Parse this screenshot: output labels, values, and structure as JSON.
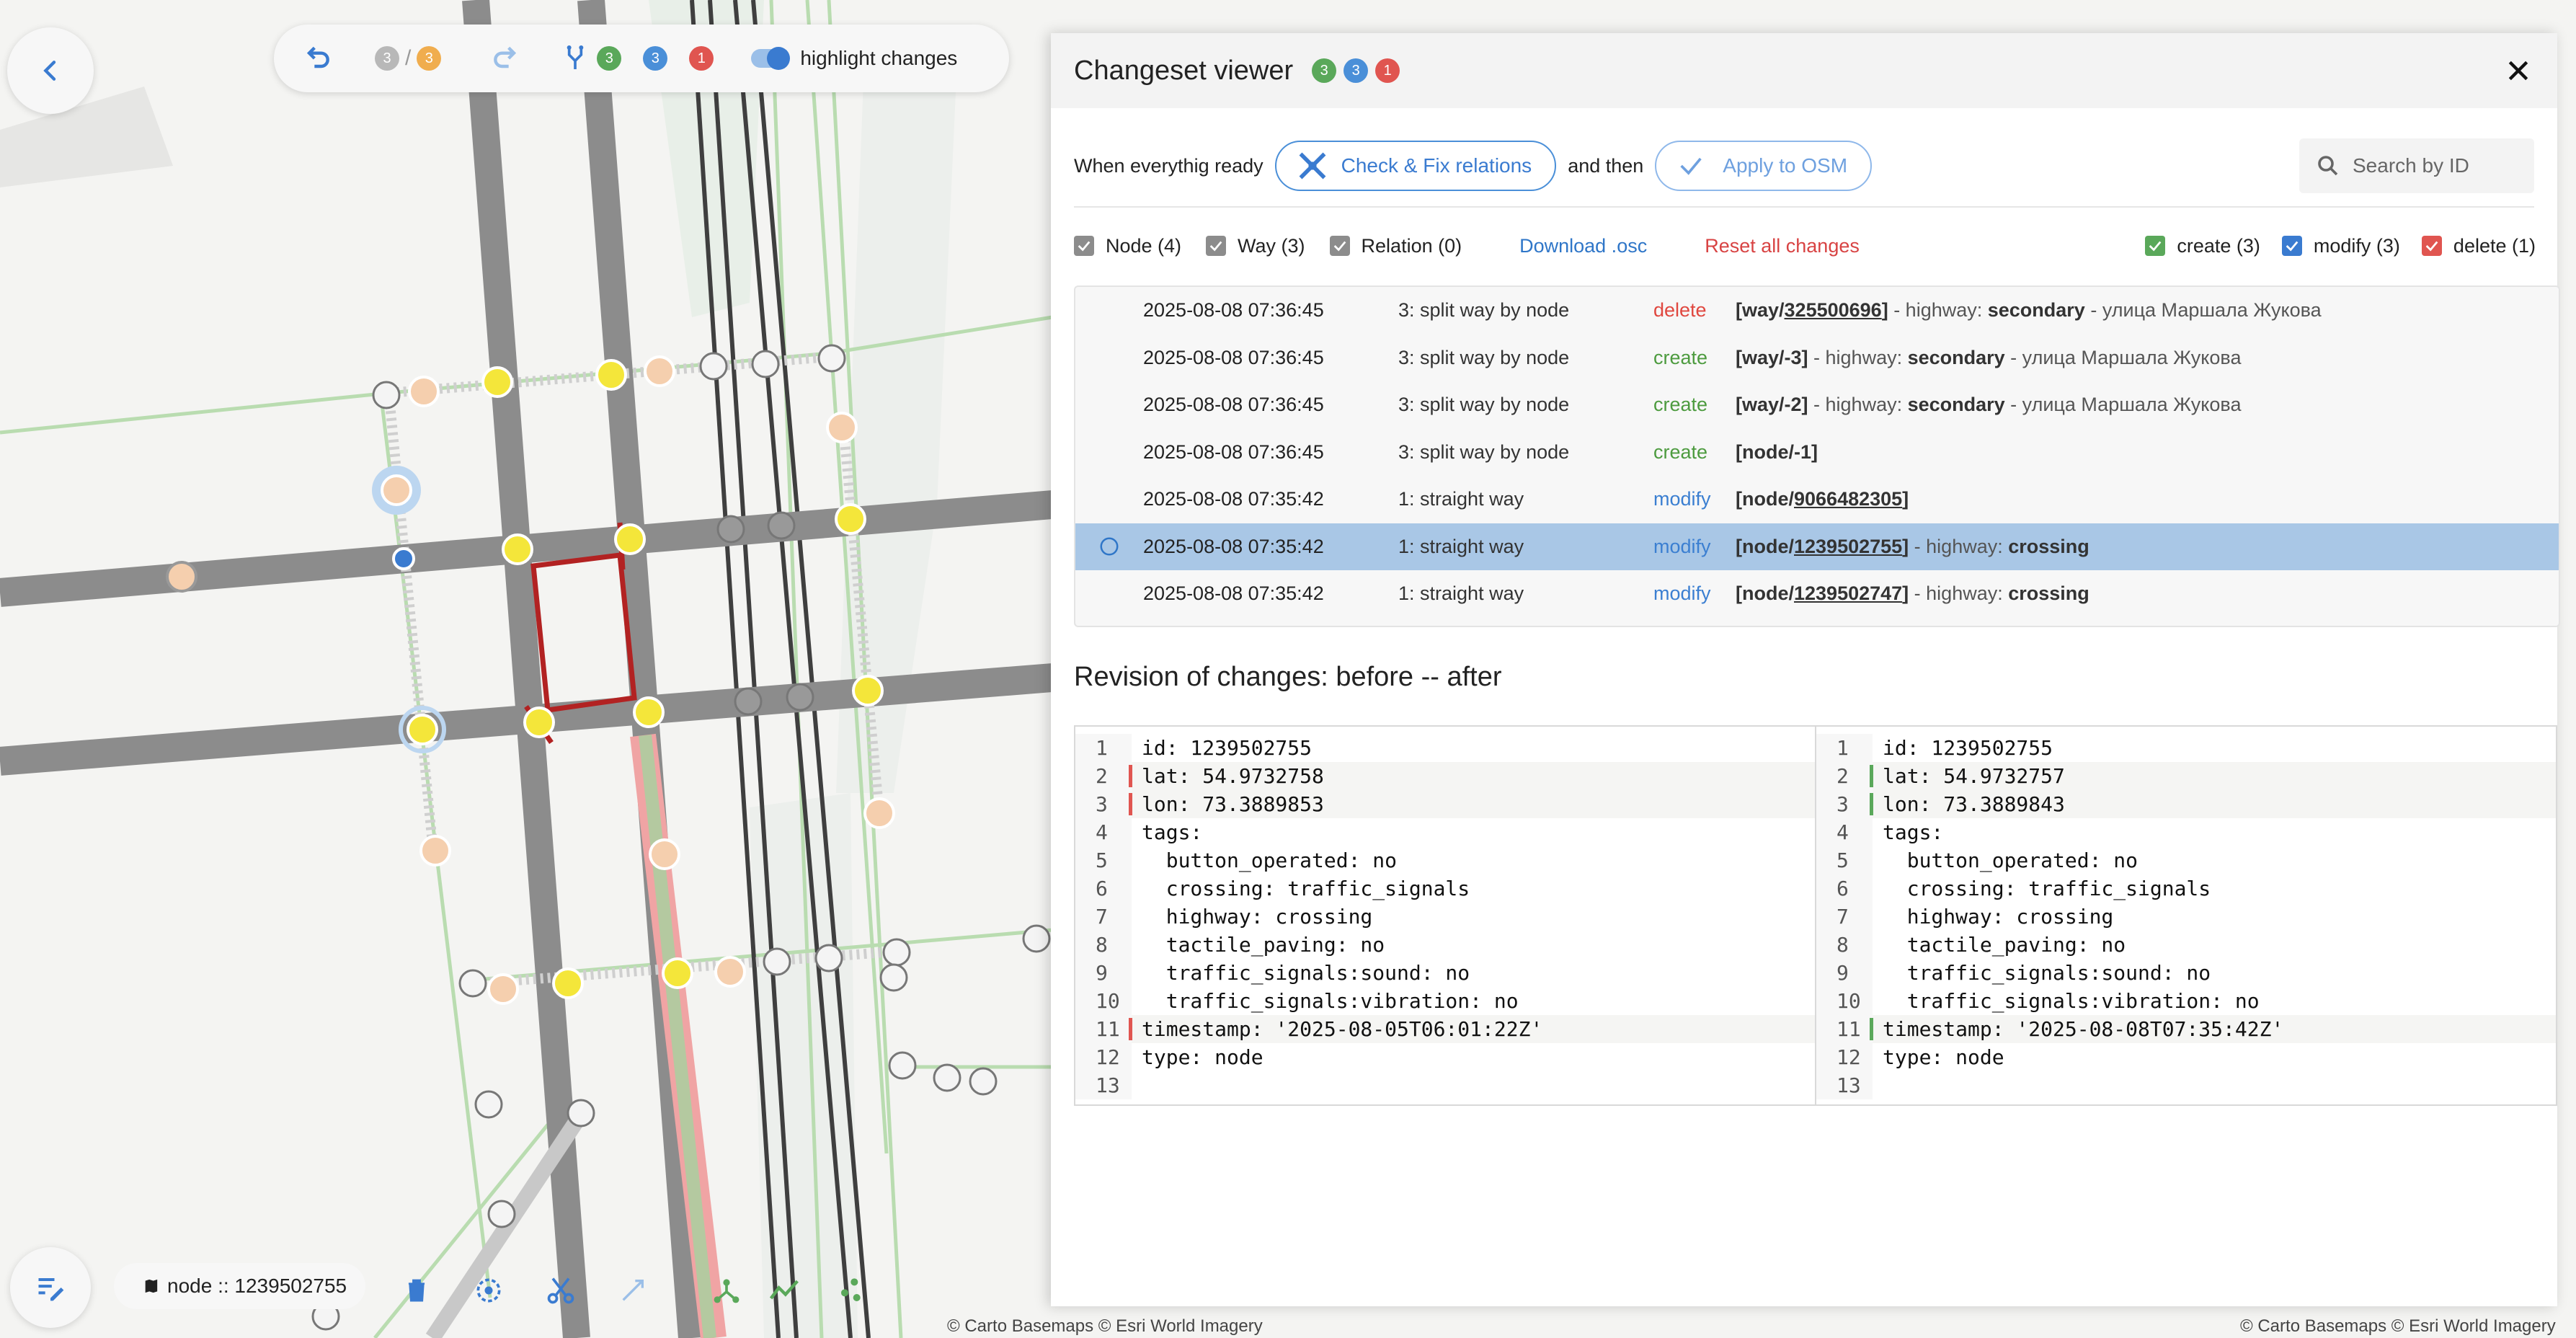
{
  "top_toolbar": {
    "history": {
      "current": "3",
      "separator": "/",
      "total": "3"
    },
    "changes_counts": {
      "create": "3",
      "modify": "3",
      "delete": "1"
    },
    "highlight_label": "highlight changes"
  },
  "bottom_toolbar": {
    "selected_label": "node :: 1239502755"
  },
  "attribution": {
    "left": "© Carto Basemaps © Esri World Imagery",
    "right": "© Carto Basemaps © Esri World Imagery"
  },
  "panel": {
    "title": "Changeset viewer",
    "badges": {
      "create": "3",
      "modify": "3",
      "delete": "1"
    },
    "ready_text": "When everythig ready",
    "check_fix_label": "Check & Fix relations",
    "and_then": "and then",
    "apply_label": "Apply to OSM",
    "search_placeholder": "Search by ID",
    "filters": {
      "node": "Node (4)",
      "way": "Way (3)",
      "relation": "Relation (0)",
      "download": "Download .osc",
      "reset": "Reset all changes",
      "create": "create (3)",
      "modify": "modify (3)",
      "delete": "delete (1)"
    },
    "rows": [
      {
        "time": "2025-08-08 07:36:45",
        "op_num": "3",
        "op": ": split way by node",
        "action": "delete",
        "pre": "[way/",
        "id": "325500696",
        "post": "]",
        "tag_text": " - highway: ",
        "tag_value": "secondary",
        "name": " - улица Маршала Жукова"
      },
      {
        "time": "2025-08-08 07:36:45",
        "op_num": "3",
        "op": ": split way by node",
        "action": "create",
        "pre": "[way/-3]",
        "id": "",
        "post": "",
        "tag_text": " - highway: ",
        "tag_value": "secondary",
        "name": " - улица Маршала Жукова"
      },
      {
        "time": "2025-08-08 07:36:45",
        "op_num": "3",
        "op": ": split way by node",
        "action": "create",
        "pre": "[way/-2]",
        "id": "",
        "post": "",
        "tag_text": " - highway: ",
        "tag_value": "secondary",
        "name": " - улица Маршала Жукова"
      },
      {
        "time": "2025-08-08 07:36:45",
        "op_num": "3",
        "op": ": split way by node",
        "action": "create",
        "pre": "[node/-1]",
        "id": "",
        "post": "",
        "tag_text": "",
        "tag_value": "",
        "name": ""
      },
      {
        "time": "2025-08-08 07:35:42",
        "op_num": "1",
        "op": ": straight way",
        "action": "modify",
        "pre": "[node/",
        "id": "9066482305",
        "post": "]",
        "tag_text": "",
        "tag_value": "",
        "name": ""
      },
      {
        "time": "2025-08-08 07:35:42",
        "op_num": "1",
        "op": ": straight way",
        "action": "modify",
        "pre": "[node/",
        "id": "1239502755",
        "post": "]",
        "tag_text": " - highway: ",
        "tag_value": "crossing",
        "name": ""
      },
      {
        "time": "2025-08-08 07:35:42",
        "op_num": "1",
        "op": ": straight way",
        "action": "modify",
        "pre": "[node/",
        "id": "1239502747",
        "post": "]",
        "tag_text": " - highway: ",
        "tag_value": "crossing",
        "name": ""
      }
    ],
    "revision_title": "Revision of changes: before -- after",
    "before": [
      "id: 1239502755",
      "lat: 54.9732758",
      "lon: 73.3889853",
      "tags:",
      "  button_operated: no",
      "  crossing: traffic_signals",
      "  highway: crossing",
      "  tactile_paving: no",
      "  traffic_signals:sound: no",
      "  traffic_signals:vibration: no",
      "timestamp: '2025-08-05T06:01:22Z'",
      "type: node",
      ""
    ],
    "after": [
      "id: 1239502755",
      "lat: 54.9732757",
      "lon: 73.3889843",
      "tags:",
      "  button_operated: no",
      "  crossing: traffic_signals",
      "  highway: crossing",
      "  tactile_paving: no",
      "  traffic_signals:sound: no",
      "  traffic_signals:vibration: no",
      "timestamp: '2025-08-08T07:35:42Z'",
      "type: node",
      ""
    ]
  },
  "colors": {
    "create": "#5aa85a",
    "modify": "#4a8fd8",
    "delete": "#e05550",
    "selected_row": "#a9c7e6",
    "accent": "#3a7bd0"
  }
}
